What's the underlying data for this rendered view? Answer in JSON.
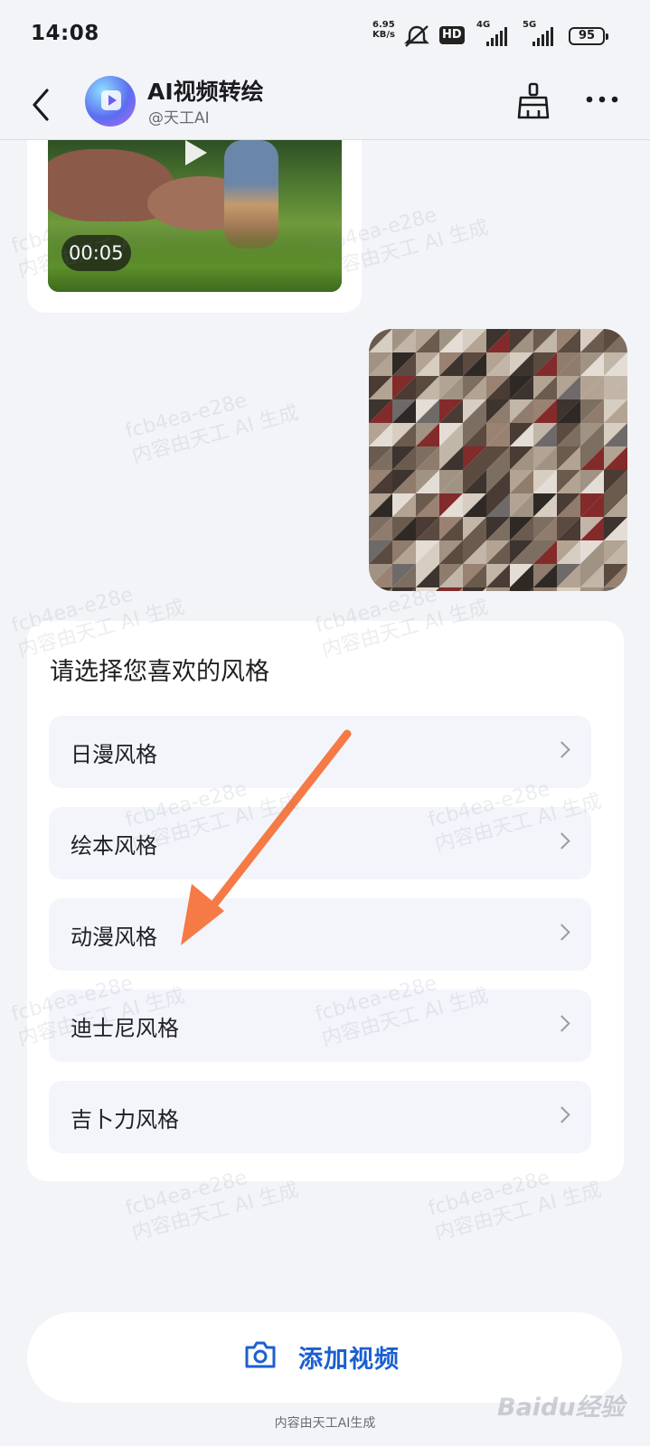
{
  "status_bar": {
    "time": "14:08",
    "net_speed_value": "6.95",
    "net_speed_unit": "KB/s",
    "hd_label": "HD",
    "net_4g": "4G",
    "net_5g": "5G",
    "battery": "95",
    "icons": [
      "mute-icon",
      "signal-icon",
      "battery-icon"
    ]
  },
  "header": {
    "title": "AI视频转绘",
    "handle": "@天工AI",
    "icons": [
      "back-arrow-icon",
      "app-logo",
      "broom-icon",
      "more-icon"
    ]
  },
  "chat": {
    "video_duration": "00:05"
  },
  "style_picker": {
    "prompt": "请选择您喜欢的风格",
    "options": [
      {
        "label": "日漫风格"
      },
      {
        "label": "绘本风格"
      },
      {
        "label": "动漫风格"
      },
      {
        "label": "迪士尼风格"
      },
      {
        "label": "吉卜力风格"
      }
    ]
  },
  "annotation": {
    "color": "#f57a45"
  },
  "watermark": {
    "line1": "fcb4ea-e28e",
    "line2": "内容由天工 AI 生成"
  },
  "footer": {
    "add_video_label": "添加视频",
    "note": "内容由天工AI生成",
    "baidu": "Baidu经验"
  },
  "colors": {
    "accent": "#1b5fd1",
    "background": "#f3f4f7",
    "option_bg": "#f3f5fb"
  }
}
